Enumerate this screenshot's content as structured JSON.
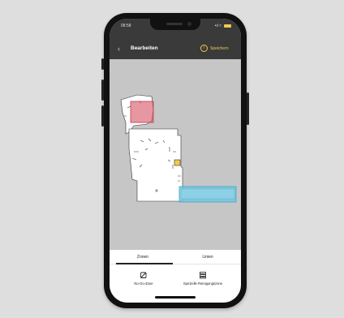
{
  "status_bar": {
    "time": "08:58",
    "signal_text": "•ıl ≈"
  },
  "header": {
    "back_icon": "chevron-left-icon",
    "title": "Bearbeiten",
    "help_icon": "help-circle-icon",
    "save_label": "Speichern"
  },
  "map": {
    "no_go_zone_color": "#d9606e",
    "cleaning_zone_color": "#6fc6de",
    "dock_marker_color": "#f2c94c",
    "background_color": "#c6c6c6"
  },
  "tabs": [
    {
      "label": "Zonen",
      "active": true
    },
    {
      "label": "Linien",
      "active": false
    }
  ],
  "actions": [
    {
      "label": "No-Go-Zone",
      "icon": "no-go-zone-icon"
    },
    {
      "label": "Spezielle Reinigungszone",
      "icon": "cleaning-zone-icon"
    }
  ],
  "colors": {
    "accent": "#f2c94c",
    "header_bg": "#3a3a3a",
    "panel_bg": "#ffffff"
  }
}
